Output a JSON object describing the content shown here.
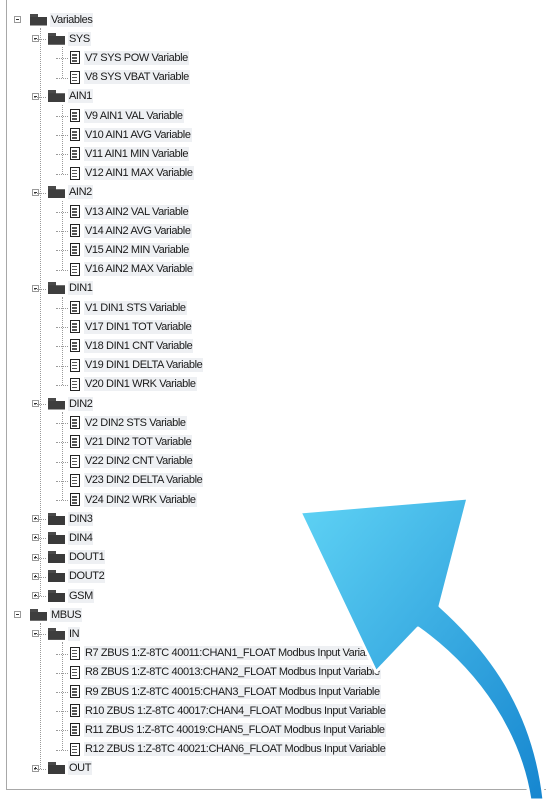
{
  "tree": {
    "root": "Variables",
    "groups": [
      {
        "label": "SYS",
        "children": [
          "V7 SYS POW Variable",
          "V8 SYS VBAT Variable"
        ]
      },
      {
        "label": "AIN1",
        "children": [
          "V9 AIN1 VAL Variable",
          "V10 AIN1 AVG Variable",
          "V11 AIN1 MIN Variable",
          "V12 AIN1 MAX Variable"
        ]
      },
      {
        "label": "AIN2",
        "children": [
          "V13 AIN2 VAL Variable",
          "V14 AIN2 AVG Variable",
          "V15 AIN2 MIN Variable",
          "V16 AIN2 MAX Variable"
        ]
      },
      {
        "label": "DIN1",
        "children": [
          "V1 DIN1 STS Variable",
          "V17 DIN1 TOT Variable",
          "V18 DIN1 CNT Variable",
          "V19 DIN1 DELTA Variable",
          "V20 DIN1 WRK Variable"
        ]
      },
      {
        "label": "DIN2",
        "children": [
          "V2 DIN2 STS Variable",
          "V21 DIN2 TOT Variable",
          "V22 DIN2 CNT Variable",
          "V23 DIN2 DELTA Variable",
          "V24 DIN2 WRK Variable"
        ]
      }
    ],
    "collapsed": [
      "DIN3",
      "DIN4",
      "DOUT1",
      "DOUT2",
      "GSM"
    ],
    "mbus": {
      "label": "MBUS",
      "in": {
        "label": "IN",
        "children": [
          "R7 ZBUS 1:Z-8TC 40011:CHAN1_FLOAT Modbus Input Variable",
          "R8 ZBUS 1:Z-8TC 40013:CHAN2_FLOAT Modbus Input Variable",
          "R9 ZBUS 1:Z-8TC 40015:CHAN3_FLOAT Modbus Input Variable",
          "R10 ZBUS 1:Z-8TC 40017:CHAN4_FLOAT Modbus Input Variable",
          "R11 ZBUS 1:Z-8TC 40019:CHAN5_FLOAT Modbus Input Variable",
          "R12 ZBUS 1:Z-8TC 40021:CHAN6_FLOAT Modbus Input Variable"
        ]
      },
      "out_label": "OUT"
    }
  },
  "colors": {
    "arrow_light": "#3fc2ee",
    "arrow_dark": "#1a8fd6",
    "tree_line": "#9a9a9a"
  }
}
